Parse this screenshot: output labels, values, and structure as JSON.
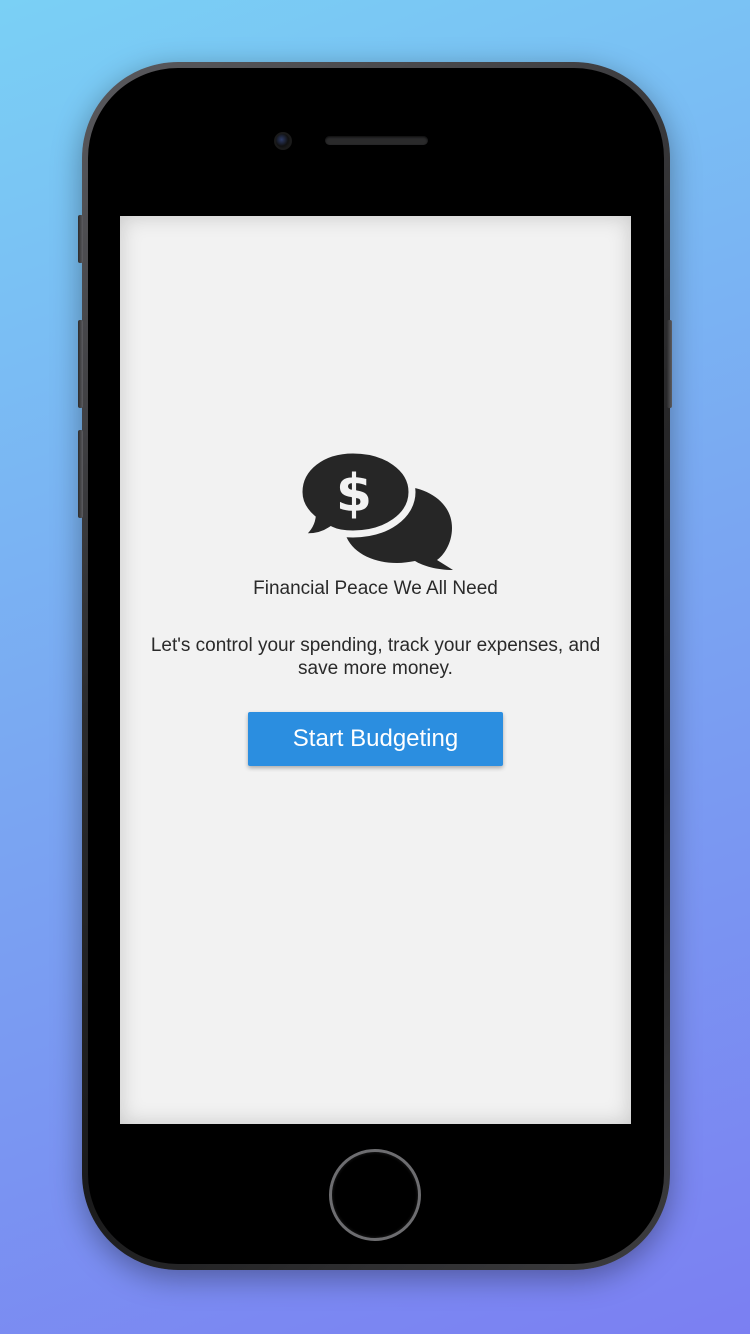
{
  "app": {
    "tagline": "Financial Peace We All Need",
    "description": "Let's control your spending, track your expenses, and save more money.",
    "start_button_label": "Start Budgeting",
    "logo_icon": "money-chat-bubbles-icon"
  },
  "colors": {
    "background_gradient_start": "#7ad0f5",
    "background_gradient_end": "#7b7ff2",
    "screen_background": "#f2f2f2",
    "button_color": "#2b8ee0",
    "text_color": "#2a2a2a",
    "icon_color": "#262626"
  }
}
